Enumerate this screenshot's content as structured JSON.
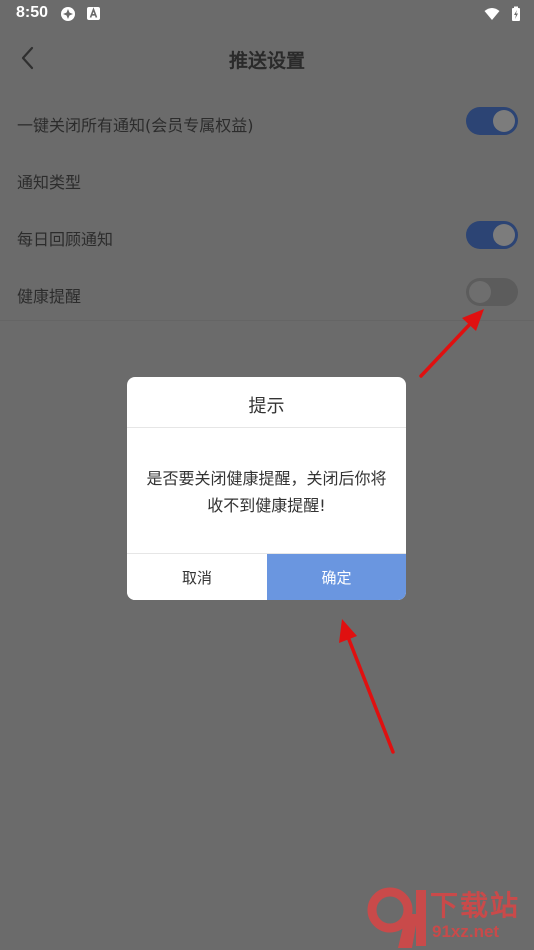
{
  "status_bar": {
    "time": "8:50"
  },
  "header": {
    "title": "推送设置"
  },
  "settings": [
    {
      "label": "一键关闭所有通知(会员专属权益)",
      "toggle": true
    },
    {
      "label": "通知类型",
      "toggle": null
    },
    {
      "label": "每日回顾通知",
      "toggle": true
    },
    {
      "label": "健康提醒",
      "toggle": false
    }
  ],
  "dialog": {
    "title": "提示",
    "message_line1": "是否要关闭健康提醒，关闭后你将",
    "message_line2": "收不到健康提醒!",
    "cancel_label": "取消",
    "confirm_label": "确定"
  },
  "watermark": {
    "title": "下载站",
    "domain": "91xz.net"
  },
  "colors": {
    "toggle_on": "#2c4474",
    "confirm_button": "#6a96e0",
    "arrow": "#e01010"
  }
}
